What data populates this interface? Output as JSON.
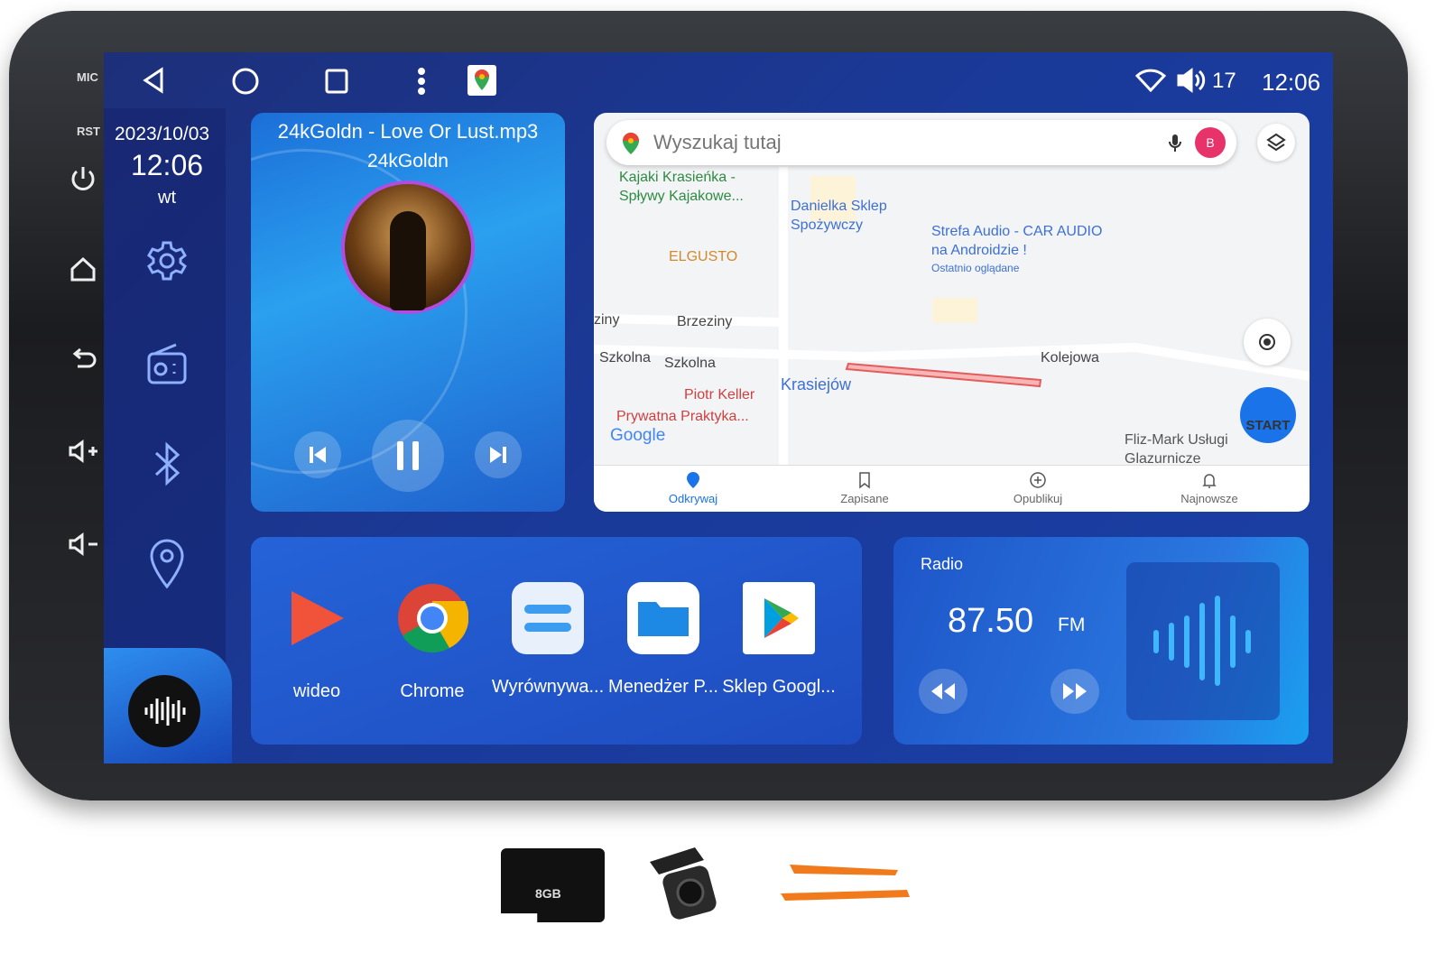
{
  "hardware": {
    "mic": "MIC",
    "rst": "RST"
  },
  "statusbar": {
    "volume": "17",
    "time": "12:06",
    "icons": [
      "back-icon",
      "home-circle-icon",
      "recents-icon",
      "more-icon",
      "google-maps-icon",
      "wifi-icon",
      "volume-icon"
    ]
  },
  "clock": {
    "date": "2023/10/03",
    "time": "12:06",
    "day": "wt"
  },
  "music": {
    "title": "24kGoldn - Love Or Lust.mp3",
    "artist": "24kGoldn"
  },
  "map": {
    "search_placeholder": "Wyszukaj tutaj",
    "avatar": "B",
    "labels": {
      "kajaki": "Kajaki Krasieńka - Spływy Kajakowe...",
      "danielka": "Danielka Sklep Spożywczy",
      "strefa": "Strefa Audio - CAR AUDIO na Androidzie !",
      "ostatnio": "Ostatnio oglądane",
      "elgusto": "ELGUSTO",
      "brzeziny": "Brzeziny",
      "ziny": "ziny",
      "szkolna1": "Szkolna",
      "szkolna2": "Szkolna",
      "kolejowa": "Kolejowa",
      "krasiejow": "Krasiejów",
      "keller": "Piotr Keller",
      "praktyka": "Prywatna Praktyka...",
      "google": "Google",
      "flizmark": "Fliz-Mark Usługi Glazurnicze",
      "start": "START"
    },
    "tabs": [
      {
        "label": "Odkrywaj",
        "active": true
      },
      {
        "label": "Zapisane"
      },
      {
        "label": "Opublikuj"
      },
      {
        "label": "Najnowsze"
      }
    ],
    "accent": "#1a73e8"
  },
  "apps": [
    {
      "label": "wideo"
    },
    {
      "label": "Chrome"
    },
    {
      "label": "Wyrównywa..."
    },
    {
      "label": "Menedżer P..."
    },
    {
      "label": "Sklep Googl..."
    }
  ],
  "radio": {
    "title": "Radio",
    "frequency": "87.50",
    "band": "FM"
  },
  "accessories": {
    "sd_card": "8GB"
  }
}
